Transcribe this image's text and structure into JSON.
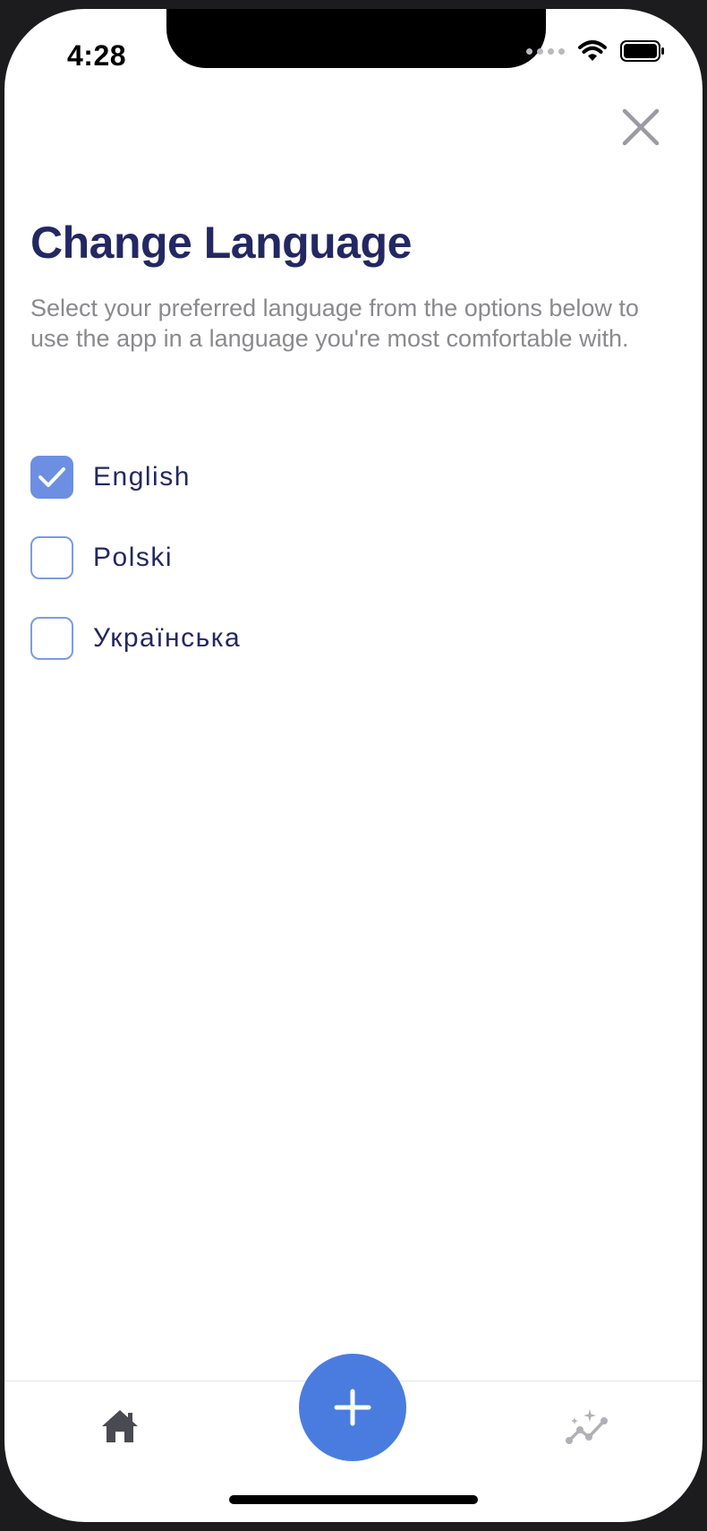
{
  "status_bar": {
    "time": "4:28",
    "icons": [
      "signal-icon",
      "wifi-icon",
      "battery-icon"
    ]
  },
  "header": {
    "close_icon": "close-icon"
  },
  "main": {
    "title": "Change Language",
    "description": "Select your preferred language from the options below to use the app in a language you're most comfortable with.",
    "languages": [
      {
        "label": "English",
        "checked": true
      },
      {
        "label": "Polski",
        "checked": false
      },
      {
        "label": "Українська",
        "checked": false
      }
    ]
  },
  "tab_bar": {
    "items": [
      {
        "name": "home",
        "icon": "home-icon"
      },
      {
        "name": "add",
        "icon": "plus-icon"
      },
      {
        "name": "stats",
        "icon": "stats-icon"
      }
    ]
  },
  "colors": {
    "title": "#232863",
    "accent": "#4a7ce0",
    "checkbox_checked": "#6c8fe2",
    "checkbox_border": "#7b9be8",
    "description": "#8a8a8e"
  }
}
